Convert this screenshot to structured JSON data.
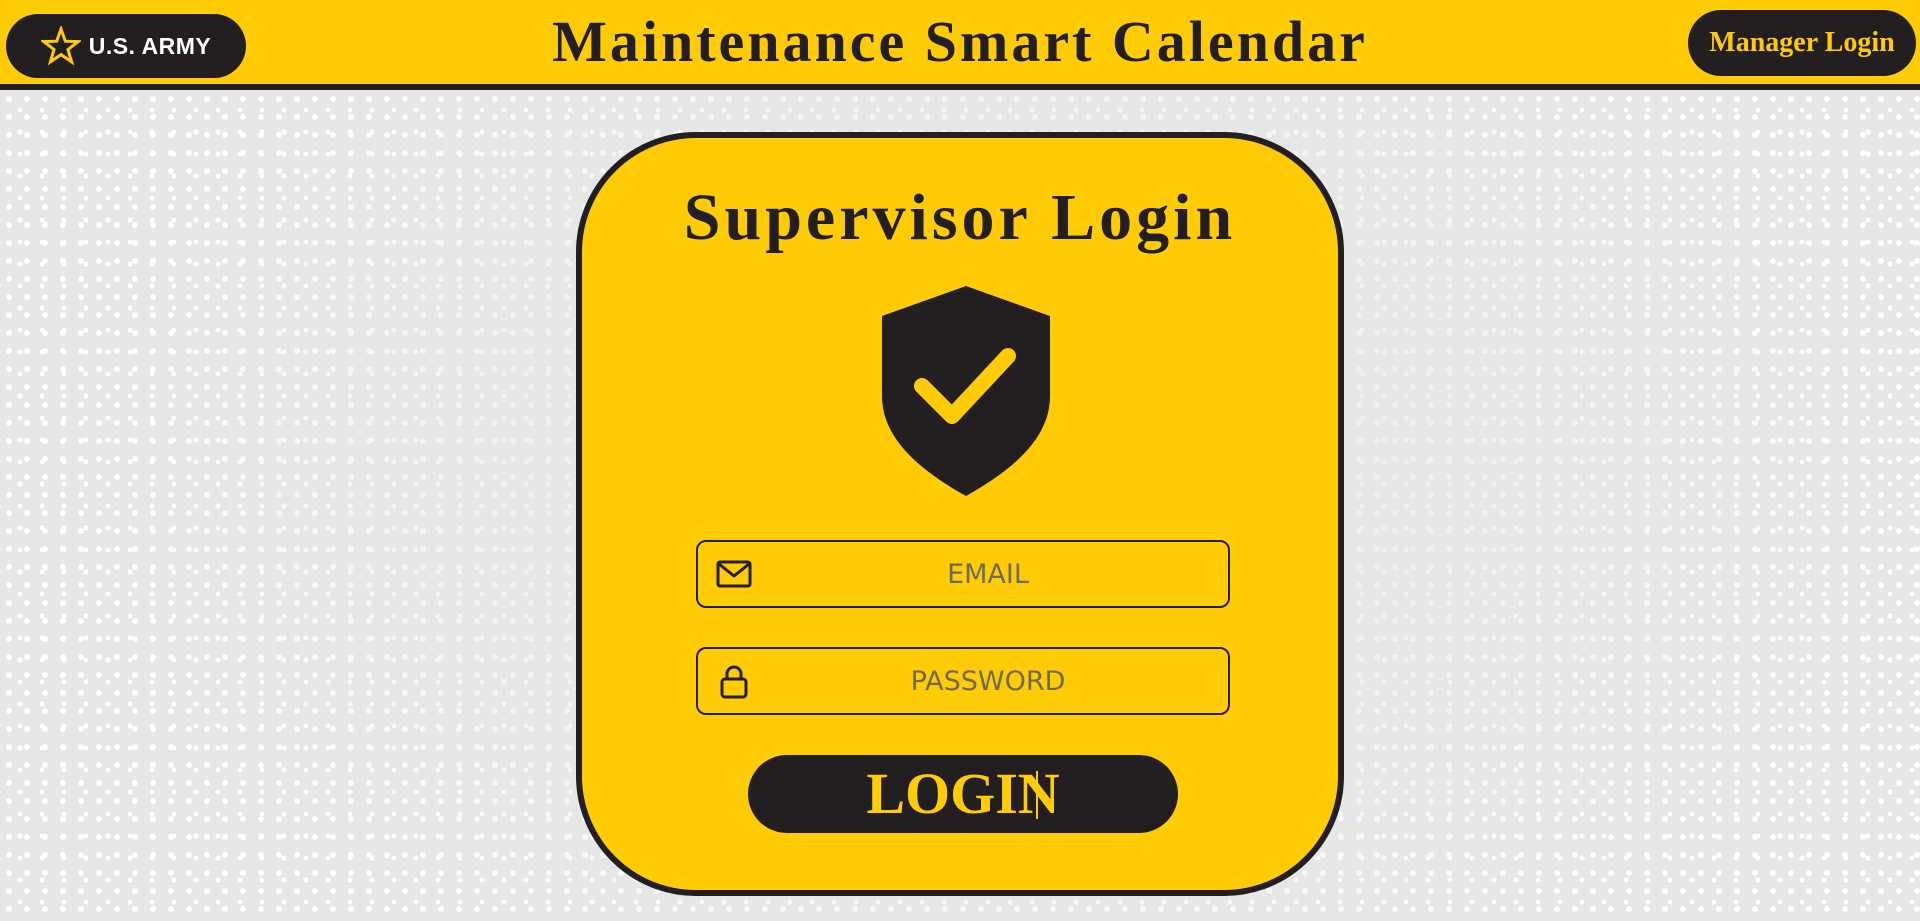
{
  "header": {
    "logo_text": "U.S. ARMY",
    "title": "Maintenance Smart Calendar",
    "manager_login_label": "Manager Login"
  },
  "login_card": {
    "title": "Supervisor Login",
    "email": {
      "placeholder": "EMAIL",
      "value": ""
    },
    "password": {
      "placeholder": "PASSWORD",
      "value": ""
    },
    "login_label": "LOGIN"
  },
  "icons": {
    "logo": "star-icon",
    "badge": "shield-check-icon",
    "email": "envelope-icon",
    "password": "lock-icon"
  },
  "colors": {
    "accent_yellow": "#ffcb05",
    "dark": "#231f20",
    "background": "#e6e6e6"
  }
}
